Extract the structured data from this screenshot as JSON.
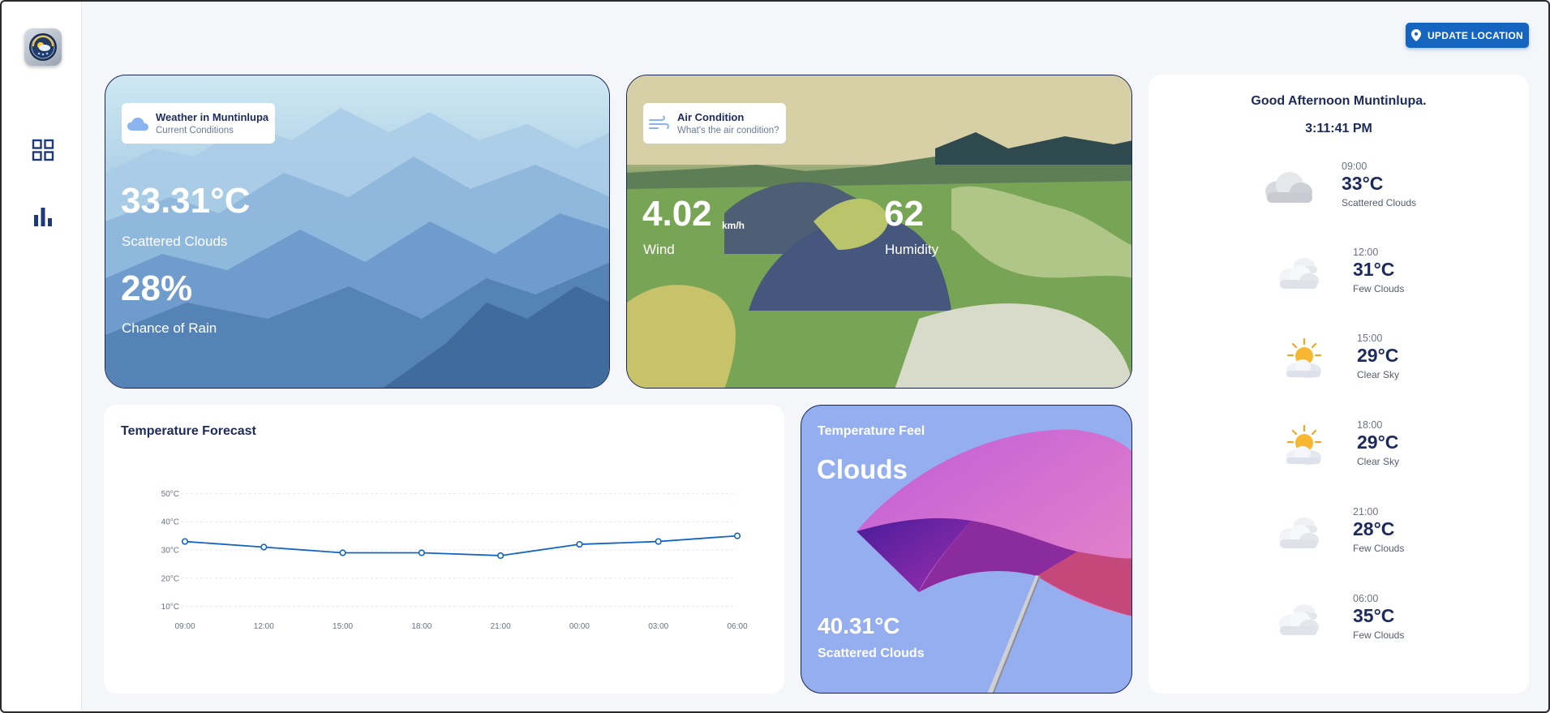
{
  "header": {
    "update_location_label": "UPDATE LOCATION"
  },
  "sidebar": {
    "items": [
      {
        "icon": "dashboard-grid-icon"
      },
      {
        "icon": "bar-chart-icon"
      }
    ]
  },
  "weather_card": {
    "title": "Weather in Muntinlupa",
    "subtitle": "Current Conditions",
    "temperature": "33.31°C",
    "condition": "Scattered Clouds",
    "rain_chance": "28%",
    "rain_label": "Chance of Rain"
  },
  "air_card": {
    "title": "Air Condition",
    "subtitle": "What's the air condition?",
    "wind_value": "4.02",
    "wind_unit": "km/h",
    "wind_label": "Wind",
    "humidity_value": "62",
    "humidity_label": "Humidity"
  },
  "forecast_card": {
    "title": "Temperature Forecast"
  },
  "chart_data": {
    "type": "line",
    "title": "Temperature Forecast",
    "categories": [
      "09:00",
      "12:00",
      "15:00",
      "18:00",
      "21:00",
      "00:00",
      "03:00",
      "06:00"
    ],
    "series": [
      {
        "values": [
          33,
          31,
          29,
          29,
          28,
          32,
          33,
          35
        ]
      }
    ],
    "y_ticks": [
      "10°C",
      "20°C",
      "30°C",
      "40°C",
      "50°C"
    ],
    "ylim": [
      5,
      55
    ],
    "grid": true,
    "color": "#1565c0"
  },
  "feel_card": {
    "title": "Temperature Feel",
    "condition": "Clouds",
    "temperature": "40.31°C",
    "description": "Scattered Clouds"
  },
  "hourly_panel": {
    "greeting": "Good Afternoon Muntinlupa.",
    "time": "3:11:41 PM",
    "items": [
      {
        "time": "09:00",
        "temp": "33°C",
        "desc": "Scattered Clouds",
        "icon": "scattered-clouds-icon"
      },
      {
        "time": "12:00",
        "temp": "31°C",
        "desc": "Few Clouds",
        "icon": "few-clouds-icon"
      },
      {
        "time": "15:00",
        "temp": "29°C",
        "desc": "Clear Sky",
        "icon": "sun-behind-cloud-icon"
      },
      {
        "time": "18:00",
        "temp": "29°C",
        "desc": "Clear Sky",
        "icon": "sun-behind-cloud-icon"
      },
      {
        "time": "21:00",
        "temp": "28°C",
        "desc": "Few Clouds",
        "icon": "few-clouds-icon"
      },
      {
        "time": "06:00",
        "temp": "35°C",
        "desc": "Few Clouds",
        "icon": "few-clouds-icon"
      }
    ]
  }
}
